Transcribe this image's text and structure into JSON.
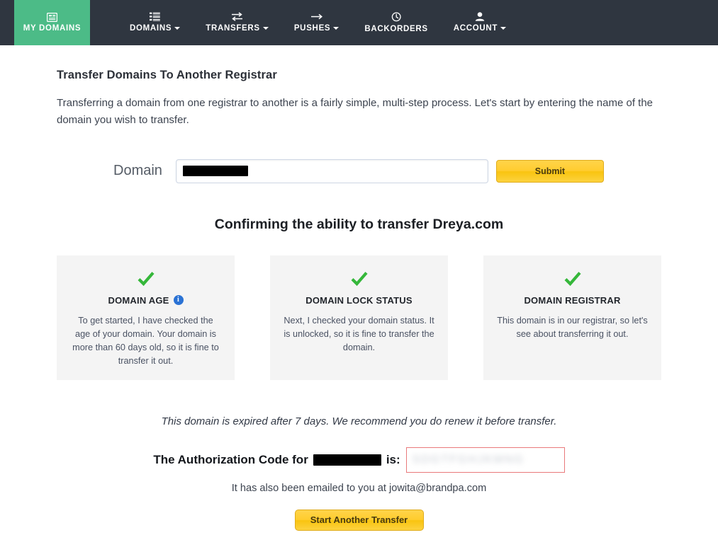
{
  "nav": {
    "active": {
      "label": "MY DOMAINS",
      "icon": "list-card-icon",
      "color": "#4cbb87"
    },
    "items": [
      {
        "label": "DOMAINS",
        "icon": "list-icon",
        "has_caret": true
      },
      {
        "label": "TRANSFERS",
        "icon": "exchange-arrows-icon",
        "has_caret": true
      },
      {
        "label": "PUSHES",
        "icon": "right-arrow-icon",
        "has_caret": true
      },
      {
        "label": "BACKORDERS",
        "icon": "clock-icon",
        "has_caret": false
      },
      {
        "label": "ACCOUNT",
        "icon": "user-icon",
        "has_caret": true
      }
    ],
    "background": "#2f3640"
  },
  "page": {
    "title": "Transfer Domains To Another Registrar",
    "intro": "Transferring a domain from one registrar to another is a fairly simple, multi-step process. Let's start by entering the name of the domain you wish to transfer."
  },
  "form": {
    "domain_label": "Domain",
    "domain_value": "",
    "domain_placeholder": "",
    "submit_label": "Submit"
  },
  "confirm": {
    "heading": "Confirming the ability to transfer Dreya.com",
    "cards": [
      {
        "status_icon": "green-check-icon",
        "title": "DOMAIN AGE",
        "info_icon": "info-icon",
        "info_glyph": "i",
        "text": "To get started, I have checked the age of your domain. Your domain is more than 60 days old, so it is fine to transfer it out."
      },
      {
        "status_icon": "green-check-icon",
        "title": "DOMAIN LOCK STATUS",
        "info_icon": null,
        "info_glyph": "",
        "text": "Next, I checked your domain status. It is unlocked, so it is fine to transfer the domain."
      },
      {
        "status_icon": "green-check-icon",
        "title": "DOMAIN REGISTRAR",
        "info_icon": null,
        "info_glyph": "",
        "text": "This domain is in our registrar, so let's see about transferring it out."
      }
    ]
  },
  "footer": {
    "expiry_note": "This domain is expired after 7 days. We recommend you do renew it before transfer.",
    "auth_prefix": "The Authorization Code for",
    "auth_domain_redacted": "",
    "auth_suffix": "is:",
    "auth_code": "SDGTFGHJKMNG",
    "email_note": "It has also been emailed to you at jowita@brandpa.com",
    "start_another_label": "Start Another Transfer"
  },
  "colors": {
    "nav_bg": "#2f3640",
    "active_green": "#4cbb87",
    "check_green": "#35b73a",
    "button_yellow": "#ffcc2e",
    "card_bg": "#f4f4f4",
    "auth_box_border": "#e9797b",
    "info_blue": "#2a72d4"
  }
}
